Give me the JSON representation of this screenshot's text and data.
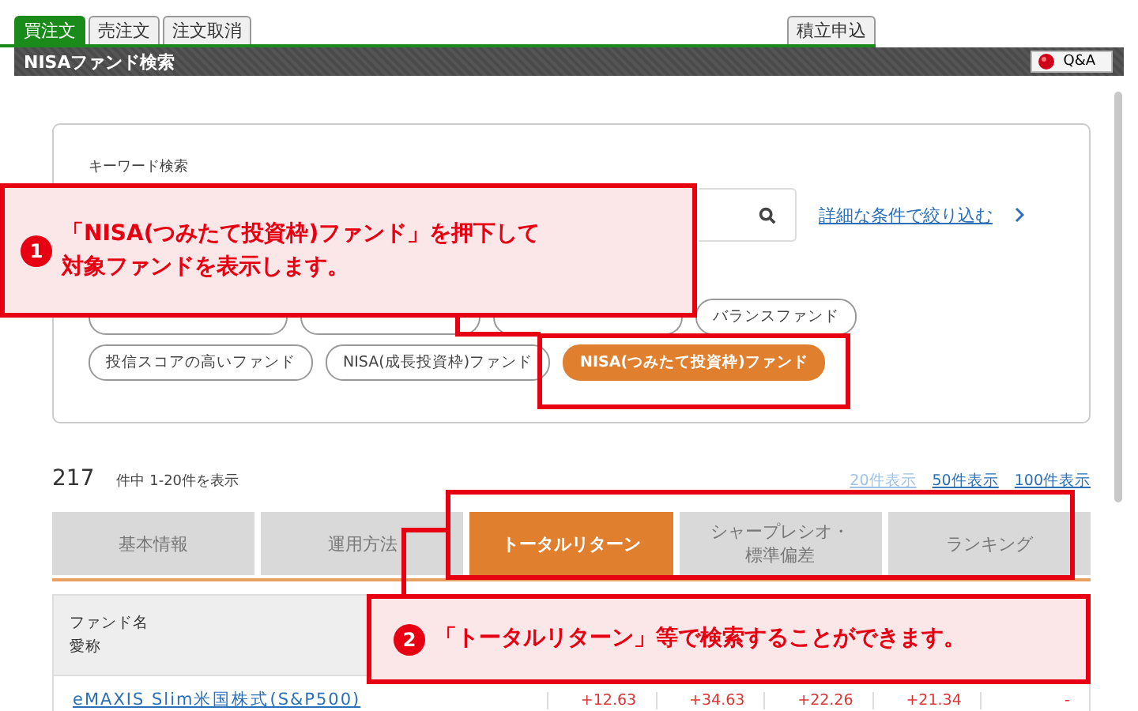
{
  "order_tabs": [
    {
      "label": "買注文",
      "selected": true
    },
    {
      "label": "売注文",
      "selected": false
    },
    {
      "label": "注文取消",
      "selected": false
    }
  ],
  "side_tab": {
    "label": "積立申込"
  },
  "title_bar": {
    "title": "NISAファンド検索",
    "help_button": "Q&A"
  },
  "search": {
    "label": "キーワード検索",
    "advanced_link": "詳細な条件で絞り込む"
  },
  "chips_row_1": [
    {
      "selected": false
    },
    {
      "selected": false
    },
    {
      "selected": false
    },
    {
      "label": "バランスファンド",
      "selected": false
    }
  ],
  "chips_row_2": [
    {
      "label": "投信スコアの高いファンド",
      "selected": false
    },
    {
      "label": "NISA(成長投資枠)ファンド",
      "selected": false
    },
    {
      "label": "NISA(つみたて投資枠)ファンド",
      "selected": true
    }
  ],
  "result": {
    "count": "217",
    "range": "件中 1-20件を表示",
    "page_sizes": [
      {
        "label": "20件表示",
        "selected": true
      },
      {
        "label": "50件表示",
        "selected": false
      },
      {
        "label": "100件表示",
        "selected": false
      }
    ]
  },
  "view_tabs": [
    {
      "label": "基本情報",
      "selected": false
    },
    {
      "label": "運用方法",
      "selected": false
    },
    {
      "label": "トータルリターン",
      "selected": true
    },
    {
      "lines": [
        "シャープレシオ・",
        "標準偏差"
      ],
      "selected": false
    },
    {
      "label": "ランキング",
      "selected": false
    }
  ],
  "table": {
    "header": [
      "ファンド名",
      "愛称"
    ],
    "rows": [
      {
        "name": "eMAXIS Slim米国株式(S&P500)",
        "values": [
          "+12.63",
          "+34.63",
          "+22.26",
          "+21.34",
          "-"
        ]
      }
    ]
  },
  "callouts": [
    {
      "number": "1",
      "lines": [
        "「NISA(つみたて投資枠)ファンド」を押下して",
        "対象ファンドを表示します。"
      ]
    },
    {
      "number": "2",
      "lines": [
        "「トータルリターン」等で検索することができます。"
      ]
    }
  ]
}
